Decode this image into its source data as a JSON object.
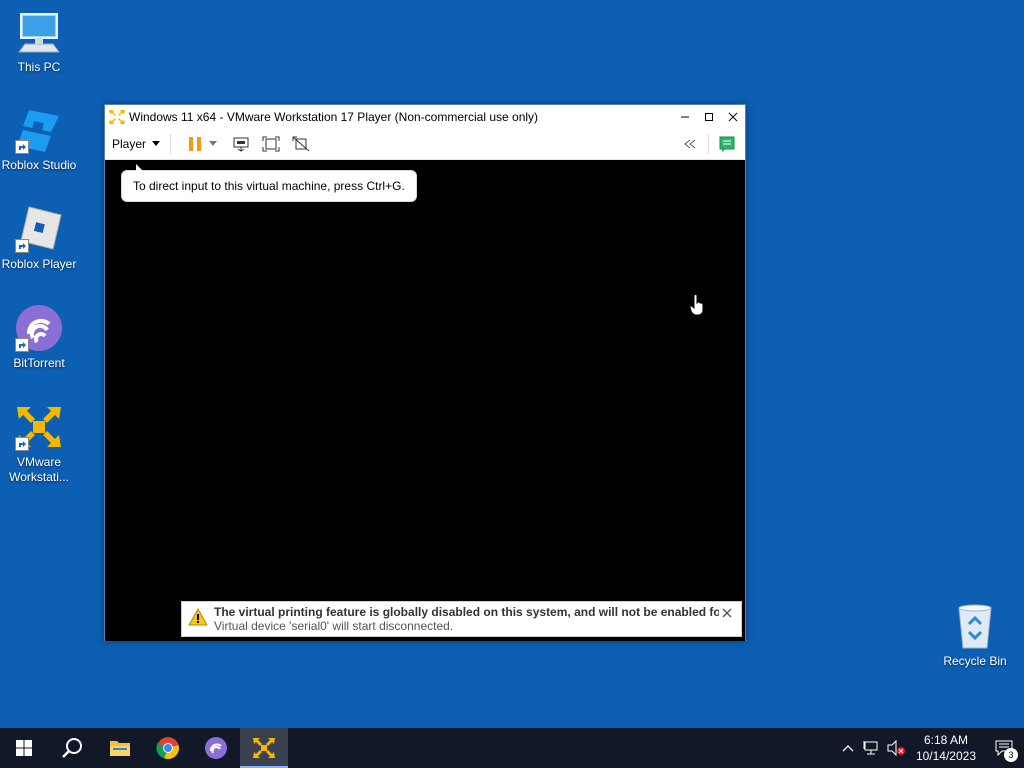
{
  "desktop": {
    "icons": [
      {
        "label": "This PC"
      },
      {
        "label": "Roblox Studio"
      },
      {
        "label": "Roblox Player"
      },
      {
        "label": "BitTorrent"
      },
      {
        "label": "VMware Workstati..."
      },
      {
        "label": "Recycle Bin"
      }
    ]
  },
  "window": {
    "title": "Windows 11 x64 - VMware Workstation 17 Player (Non-commercial use only)",
    "player_menu": "Player",
    "tooltip": "To direct input to this virtual machine, press Ctrl+G.",
    "notification": {
      "line1": "The virtual printing feature is globally disabled on this system, and will not be enabled for t...",
      "line2": "Virtual device 'serial0' will start disconnected."
    }
  },
  "taskbar": {
    "time": "6:18 AM",
    "date": "10/14/2023",
    "notification_count": "3"
  },
  "colors": {
    "desktop": "#0d5fb3",
    "taskbar": "#111827",
    "pause_orange": "#f39c12",
    "vmware_yellow": "#f5b800"
  }
}
